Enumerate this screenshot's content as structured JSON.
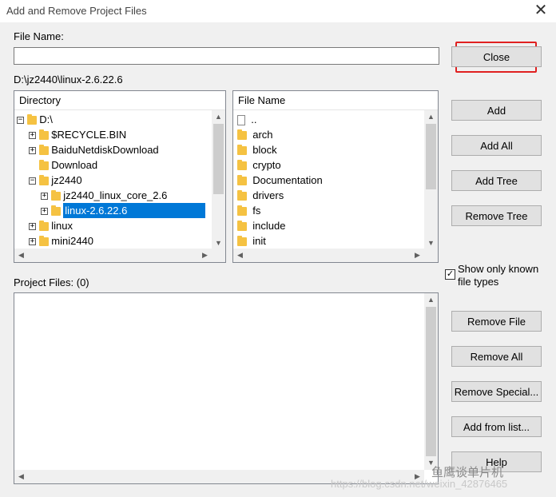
{
  "window": {
    "title": "Add and Remove Project Files",
    "close_glyph": "✕"
  },
  "file_name": {
    "label": "File Name:",
    "value": ""
  },
  "current_path": "D:\\jz2440\\linux-2.6.22.6",
  "buttons": {
    "close": "Close",
    "add": "Add",
    "add_all": "Add All",
    "add_tree": "Add Tree",
    "remove_tree": "Remove Tree",
    "remove_file": "Remove File",
    "remove_all": "Remove All",
    "remove_special": "Remove Special...",
    "add_from_list": "Add from list...",
    "help": "Help"
  },
  "directory": {
    "header": "Directory",
    "items": [
      {
        "label": "D:\\",
        "expander": "−",
        "level": 0
      },
      {
        "label": "$RECYCLE.BIN",
        "expander": "+",
        "level": 1
      },
      {
        "label": "BaiduNetdiskDownload",
        "expander": "+",
        "level": 1
      },
      {
        "label": "Download",
        "expander": "",
        "level": 1
      },
      {
        "label": "jz2440",
        "expander": "−",
        "level": 1
      },
      {
        "label": "jz2440_linux_core_2.6",
        "expander": "+",
        "level": 2
      },
      {
        "label": "linux-2.6.22.6",
        "expander": "+",
        "level": 2,
        "selected": true
      },
      {
        "label": "linux",
        "expander": "+",
        "level": 1
      },
      {
        "label": "mini2440",
        "expander": "+",
        "level": 1
      }
    ]
  },
  "files": {
    "header": "File Name",
    "items": [
      {
        "label": "..",
        "type": "file"
      },
      {
        "label": "arch",
        "type": "folder"
      },
      {
        "label": "block",
        "type": "folder"
      },
      {
        "label": "crypto",
        "type": "folder"
      },
      {
        "label": "Documentation",
        "type": "folder"
      },
      {
        "label": "drivers",
        "type": "folder"
      },
      {
        "label": "fs",
        "type": "folder"
      },
      {
        "label": "include",
        "type": "folder"
      },
      {
        "label": "init",
        "type": "folder"
      }
    ]
  },
  "show_known": {
    "label_line1": "Show only known",
    "label_line2": "file types",
    "checked": true,
    "check_glyph": "✓"
  },
  "project_files": {
    "label": "Project Files: (0)"
  },
  "watermark": {
    "wechat": "鱼鹰谈单片机",
    "url": "https://blog.csdn.net/weixin_42876465"
  },
  "colors": {
    "selection": "#0078d7",
    "highlight_border": "#e02020",
    "folder": "#f5c242"
  }
}
